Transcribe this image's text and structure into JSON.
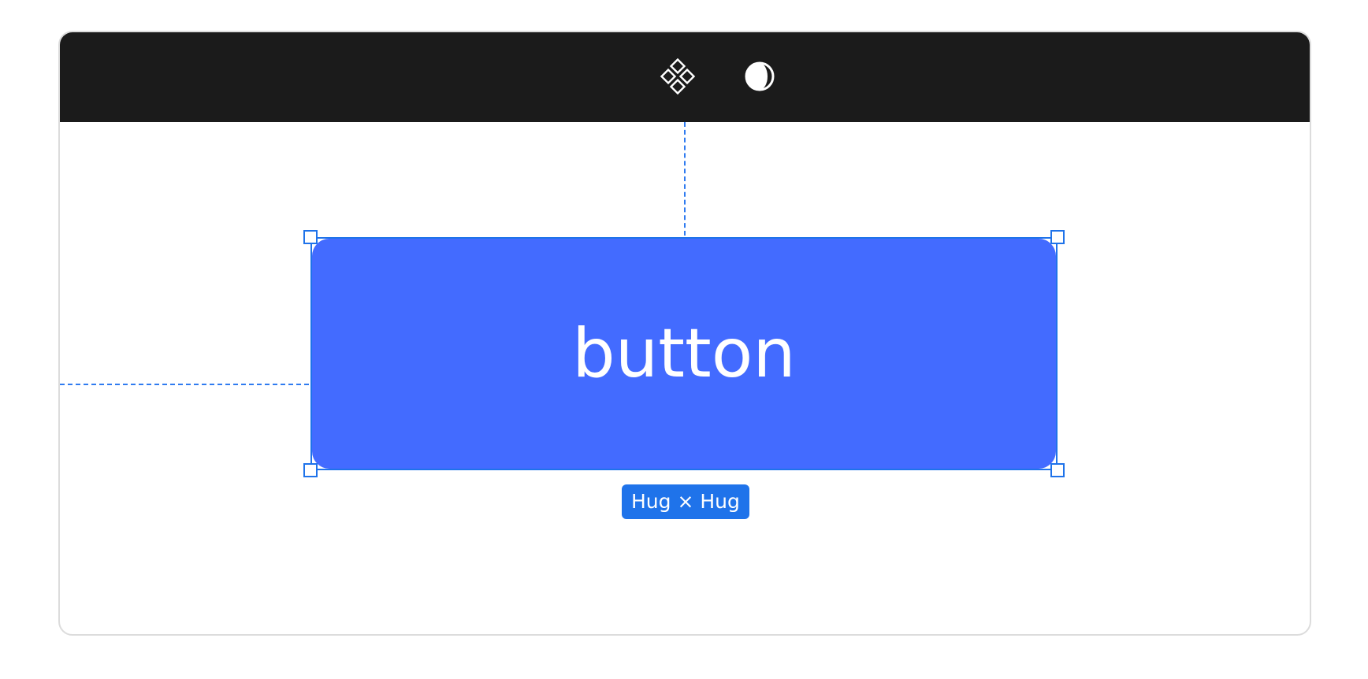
{
  "toolbar": {
    "icons": [
      {
        "name": "component-icon",
        "label": ""
      },
      {
        "name": "theme-toggle-icon",
        "label": ""
      }
    ]
  },
  "canvas": {
    "button": {
      "label": "button",
      "fill_color": "#436bff",
      "text_color": "#ffffff"
    },
    "size_badge": {
      "text": "Hug × Hug",
      "color": "#1f73ea"
    },
    "selection_color": "#1f73ea",
    "guide_color": "#2f7bf0"
  },
  "toolbar_color": "#1b1b1b"
}
